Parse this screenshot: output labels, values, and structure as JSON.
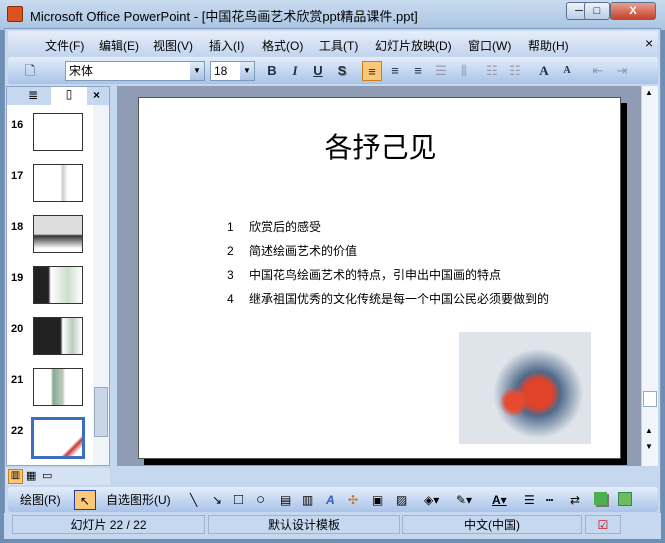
{
  "window": {
    "title": "Microsoft Office PowerPoint - [中国花鸟画艺术欣赏ppt精品课件.ppt]",
    "minimize": "─",
    "maximize": "□",
    "close": "X"
  },
  "menu": [
    {
      "label": "文件(F)"
    },
    {
      "label": "编辑(E)"
    },
    {
      "label": "视图(V)"
    },
    {
      "label": "插入(I)"
    },
    {
      "label": "格式(O)"
    },
    {
      "label": "工具(T)"
    },
    {
      "label": "幻灯片放映(D)"
    },
    {
      "label": "窗口(W)"
    },
    {
      "label": "帮助(H)"
    }
  ],
  "menu_close": "×",
  "toolbar": {
    "font": "宋体",
    "size": "18",
    "bold": "B",
    "italic": "I",
    "underline": "U",
    "shadow": "S"
  },
  "panel": {
    "close": "×",
    "slides": [
      {
        "n": "16"
      },
      {
        "n": "17"
      },
      {
        "n": "18"
      },
      {
        "n": "19"
      },
      {
        "n": "20"
      },
      {
        "n": "21"
      },
      {
        "n": "22"
      }
    ],
    "selected": "22"
  },
  "slide": {
    "title": "各抒己见",
    "bullets": [
      {
        "n": "1",
        "text": "欣赏后的感受"
      },
      {
        "n": "2",
        "text": "简述绘画艺术的价值"
      },
      {
        "n": "3",
        "text": "中国花鸟绘画艺术的特点，引申出中国画的特点"
      },
      {
        "n": "4",
        "text": "继承祖国优秀的文化传统是每一个中国公民必须要做到的"
      }
    ]
  },
  "drawbar": {
    "draw": "绘图(R)",
    "autoshapes": "自选图形(U)"
  },
  "status": {
    "slide": "幻灯片 22 / 22",
    "template": "默认设计模板",
    "language": "中文(中国)"
  }
}
